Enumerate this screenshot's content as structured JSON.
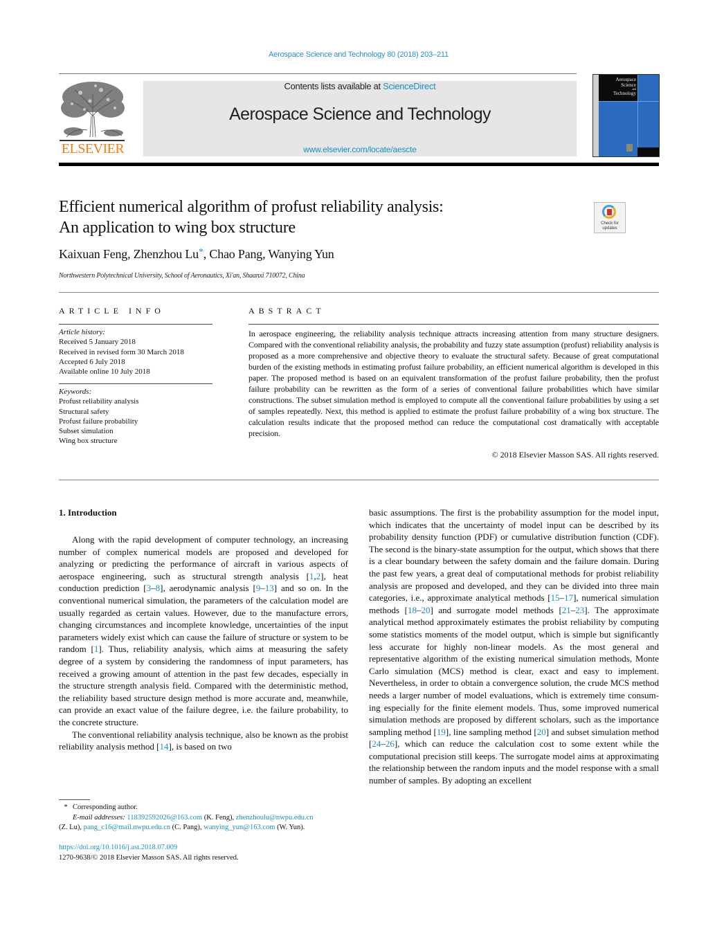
{
  "journal_ref": "Aerospace Science and Technology 80 (2018) 203–211",
  "header": {
    "publisher_logo_text": "ELSEVIER",
    "contents_prefix": "Contents lists available at ",
    "contents_link": "ScienceDirect",
    "journal_title": "Aerospace Science and Technology",
    "journal_url": "www.elsevier.com/locate/aescte",
    "cover_lines": [
      "Aerospace",
      "Science",
      "and",
      "Technology"
    ]
  },
  "article": {
    "title_line1": "Efficient numerical algorithm of profust reliability analysis:",
    "title_line2": "An application to wing box structure",
    "check_updates_label": [
      "Check for",
      "updates"
    ],
    "authors": [
      {
        "name": "Kaixuan Feng",
        "sep": ", "
      },
      {
        "name": "Zhenzhou Lu",
        "mark": "*",
        "sep": ", "
      },
      {
        "name": "Chao Pang",
        "sep": ", "
      },
      {
        "name": "Wanying Yun",
        "sep": ""
      }
    ],
    "affiliation": "Northwestern Polytechnical University, School of Aeronautics, Xi'an, Shaanxi 710072, China"
  },
  "article_info": {
    "heading": "ARTICLE INFO",
    "history_label": "Article history:",
    "history": [
      "Received 5 January 2018",
      "Received in revised form 30 March 2018",
      "Accepted 6 July 2018",
      "Available online 10 July 2018"
    ],
    "keywords_label": "Keywords:",
    "keywords": [
      "Profust reliability analysis",
      "Structural safety",
      "Profust failure probability",
      "Subset simulation",
      "Wing box structure"
    ]
  },
  "abstract": {
    "heading": "ABSTRACT",
    "text": "In aerospace engineering, the reliability analysis technique attracts increasing attention from many structure designers. Compared with the conventional reliability analysis, the probability and fuzzy state assumption (profust) reliability analysis is proposed as a more comprehensive and objective theory to evaluate the structural safety. Because of great computational burden of the existing methods in estimating profust failure probability, an efficient numerical algorithm is developed in this paper. The proposed method is based on an equivalent transformation of the profust failure probability, then the profust failure probability can be rewritten as the form of a series of conventional failure probabilities which have similar constructions. The subset simulation method is employed to compute all the conventional failure probabilities by using a set of samples repeatedly. Next, this method is applied to estimate the profust failure probability of a wing box structure. The calculation results indicate that the proposed method can reduce the computational cost dramatically with acceptable precision.",
    "copyright": "© 2018 Elsevier Masson SAS. All rights reserved."
  },
  "body": {
    "section_heading": "1. Introduction",
    "left_paragraphs": [
      [
        {
          "t": "Along with the rapid development of computer technology, an increasing number of complex numerical models are proposed and developed for analyzing or predicting the performance of aircraft in various aspects of aerospace engineering, such as structural strength analysis ["
        },
        {
          "ref": "1"
        },
        {
          "t": ","
        },
        {
          "ref": "2"
        },
        {
          "t": "], heat conduction prediction ["
        },
        {
          "ref": "3"
        },
        {
          "t": "–"
        },
        {
          "ref": "8"
        },
        {
          "t": "], aerody­namic analysis ["
        },
        {
          "ref": "9"
        },
        {
          "t": "–"
        },
        {
          "ref": "13"
        },
        {
          "t": "] and so on. In the conventional numerical simulation, the parameters of the calculation model are usually re­garded as certain values. However, due to the manufacture errors, changing circumstances and incomplete knowledge, uncertainties of the input parameters widely exist which can cause the failure of structure or system to be random ["
        },
        {
          "ref": "1"
        },
        {
          "t": "]. Thus, reliability analy­sis, which aims at measuring the safety degree of a system by considering the randomness of input parameters, has received a growing amount of attention in the past few decades, especially in the structure strength analysis field. Compared with the determin­istic method, the reliability based structure design method is more accurate and, meanwhile, can provide an exact value of the failure degree, i.e. the failure probability, to the concrete structure."
        }
      ],
      [
        {
          "t": "The conventional reliability analysis technique, also be known as the probist reliability analysis method ["
        },
        {
          "ref": "14"
        },
        {
          "t": "], is based on two"
        }
      ]
    ],
    "right_paragraphs": [
      [
        {
          "t": "basic assumptions. The first is the probability assumption for the model input, which indicates that the uncertainty of model in­put can be described by its probability density function (PDF) or cumulative distribution function (CDF). The second is the binary-state assumption for the output, which shows that there is a clear boundary between the safety domain and the failure domain. Dur­ing the past few years, a great deal of computational methods for probist reliability analysis are proposed and developed, and they can be divided into three main categories, i.e., approximate an­alytical methods ["
        },
        {
          "ref": "15"
        },
        {
          "t": "–"
        },
        {
          "ref": "17"
        },
        {
          "t": "], numerical simulation methods ["
        },
        {
          "ref": "18"
        },
        {
          "t": "–"
        },
        {
          "ref": "20"
        },
        {
          "t": "] and surrogate model methods ["
        },
        {
          "ref": "21"
        },
        {
          "t": "–"
        },
        {
          "ref": "23"
        },
        {
          "t": "]. The approximate analytical method approximately estimates the probist reliability by comput­ing some statistics moments of the model output, which is simple but significantly less accurate for highly non-linear models. As the most general and representative algorithm of the existing numer­ical simulation methods, Monte Carlo simulation (MCS) method is clear, exact and easy to implement. Nevertheless, in order to ob­tain a convergence solution, the crude MCS method needs a larger number of model evaluations, which is extremely time consum­ing especially for the finite element models. Thus, some improved numerical simulation methods are proposed by different schol­ars, such as the importance sampling method ["
        },
        {
          "ref": "19"
        },
        {
          "t": "], line sampling method ["
        },
        {
          "ref": "20"
        },
        {
          "t": "] and subset simulation method ["
        },
        {
          "ref": "24"
        },
        {
          "t": "–"
        },
        {
          "ref": "26"
        },
        {
          "t": "], which can re­duce the calculation cost to some extent while the computational precision still keeps. The surrogate model aims at approximating the relationship between the random inputs and the model re­sponse with a small number of samples. By adopting an excellent"
        }
      ]
    ]
  },
  "footnotes": {
    "star": "*",
    "corresponding": "Corresponding author.",
    "email_label": "E-mail addresses:",
    "emails": [
      {
        "email": "118392592026@163.com",
        "who": "(K. Feng)"
      },
      {
        "email": "zhenzhoulu@nwpu.edu.cn",
        "who": "(Z. Lu)"
      },
      {
        "email": "pang_c16@mail.nwpu.edu.cn",
        "who": "(C. Pang)"
      },
      {
        "email": "wanying_yun@163.com",
        "who": "(W. Yun)."
      }
    ],
    "doi": "https://doi.org/10.1016/j.ast.2018.07.009",
    "issn_line": "1270-9638/© 2018 Elsevier Masson SAS. All rights reserved."
  }
}
